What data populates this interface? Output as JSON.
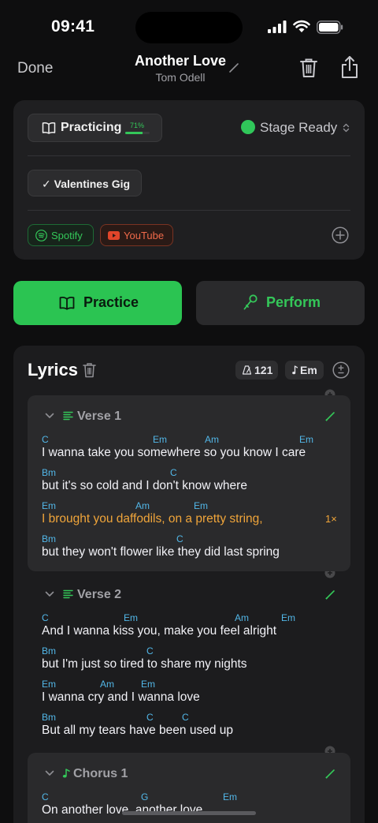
{
  "status_bar": {
    "time": "09:41"
  },
  "nav": {
    "done_label": "Done",
    "title": "Another Love",
    "artist": "Tom Odell"
  },
  "status_card": {
    "status_label": "Practicing",
    "progress_label": "71%",
    "progress_fraction": 0.71,
    "stage_label": "Stage Ready",
    "stage_color": "#30c75a",
    "gig_label": "Valentines Gig",
    "links": [
      {
        "label": "Spotify",
        "icon": "spotify-icon",
        "color": "#34c759"
      },
      {
        "label": "YouTube",
        "icon": "youtube-icon",
        "color": "#f06a4a"
      }
    ]
  },
  "modes": {
    "practice_label": "Practice",
    "perform_label": "Perform"
  },
  "lyrics": {
    "title": "Lyrics",
    "bpm": "121",
    "key": "Em",
    "sections": [
      {
        "name": "Verse 1",
        "lines": [
          {
            "words": "I wanna take you somewhere so you know I care",
            "chords": [
              "C",
              "Em",
              "Am",
              "Em"
            ]
          },
          {
            "words": "but it's so cold and I don't know where",
            "chords": [
              "Bm",
              "C"
            ]
          },
          {
            "words": "I brought you daffodils, on a pretty string,",
            "chords": [
              "Em",
              "Am",
              "Em"
            ],
            "highlighted": true,
            "repeat": "1×"
          },
          {
            "words": "but they won't flower like they did last spring",
            "chords": [
              "Bm",
              "C"
            ]
          }
        ]
      },
      {
        "name": "Verse 2",
        "lines": [
          {
            "words": "And I wanna kiss you, make you feel alright",
            "chords": [
              "C",
              "Em",
              "Am",
              "Em"
            ]
          },
          {
            "words": "but I'm just so tired to share my nights",
            "chords": [
              "Bm",
              "C"
            ]
          },
          {
            "words": "I wanna cry and I wanna love",
            "chords": [
              "Em",
              "Am",
              "Em"
            ]
          },
          {
            "words": "But all my tears have been used up",
            "chords": [
              "Bm",
              "C",
              "C"
            ]
          }
        ]
      },
      {
        "name": "Chorus 1",
        "lines": [
          {
            "words": "On another love, another love",
            "chords": [
              "C",
              "G",
              "Em"
            ]
          }
        ]
      }
    ]
  },
  "colors": {
    "accent": "#34c759",
    "chord": "#52b7e8",
    "highlight": "#f0a53a"
  }
}
